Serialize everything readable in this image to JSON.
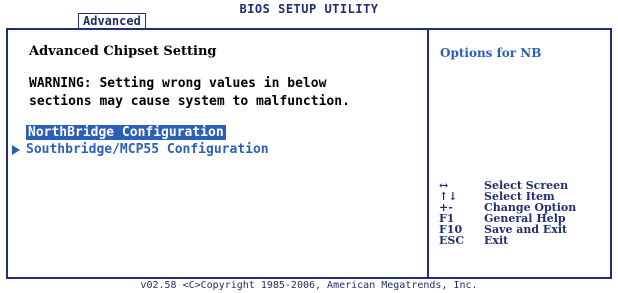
{
  "header": {
    "title": "BIOS SETUP UTILITY",
    "active_tab": "Advanced"
  },
  "main": {
    "section_title": "Advanced Chipset Setting",
    "warning_line1": "WARNING: Setting wrong values in below",
    "warning_line2": "sections may cause system to malfunction.",
    "items": [
      {
        "label": "NorthBridge Configuration",
        "selected": true
      },
      {
        "label": "Southbridge/MCP55 Configuration",
        "selected": false
      }
    ]
  },
  "help": {
    "text": "Options for NB",
    "keys": [
      {
        "key": "↔",
        "desc": "Select Screen"
      },
      {
        "key": "↑↓",
        "desc": "Select Item"
      },
      {
        "key": "+-",
        "desc": "Change Option"
      },
      {
        "key": "F1",
        "desc": "General Help"
      },
      {
        "key": "F10",
        "desc": "Save and Exit"
      },
      {
        "key": "ESC",
        "desc": "Exit"
      }
    ]
  },
  "footer": {
    "text": "v02.58 <C>Copyright 1985-2006, American Megatrends, Inc."
  },
  "colors": {
    "frame": "#1f2f6f",
    "accent": "#2b5fb8"
  }
}
